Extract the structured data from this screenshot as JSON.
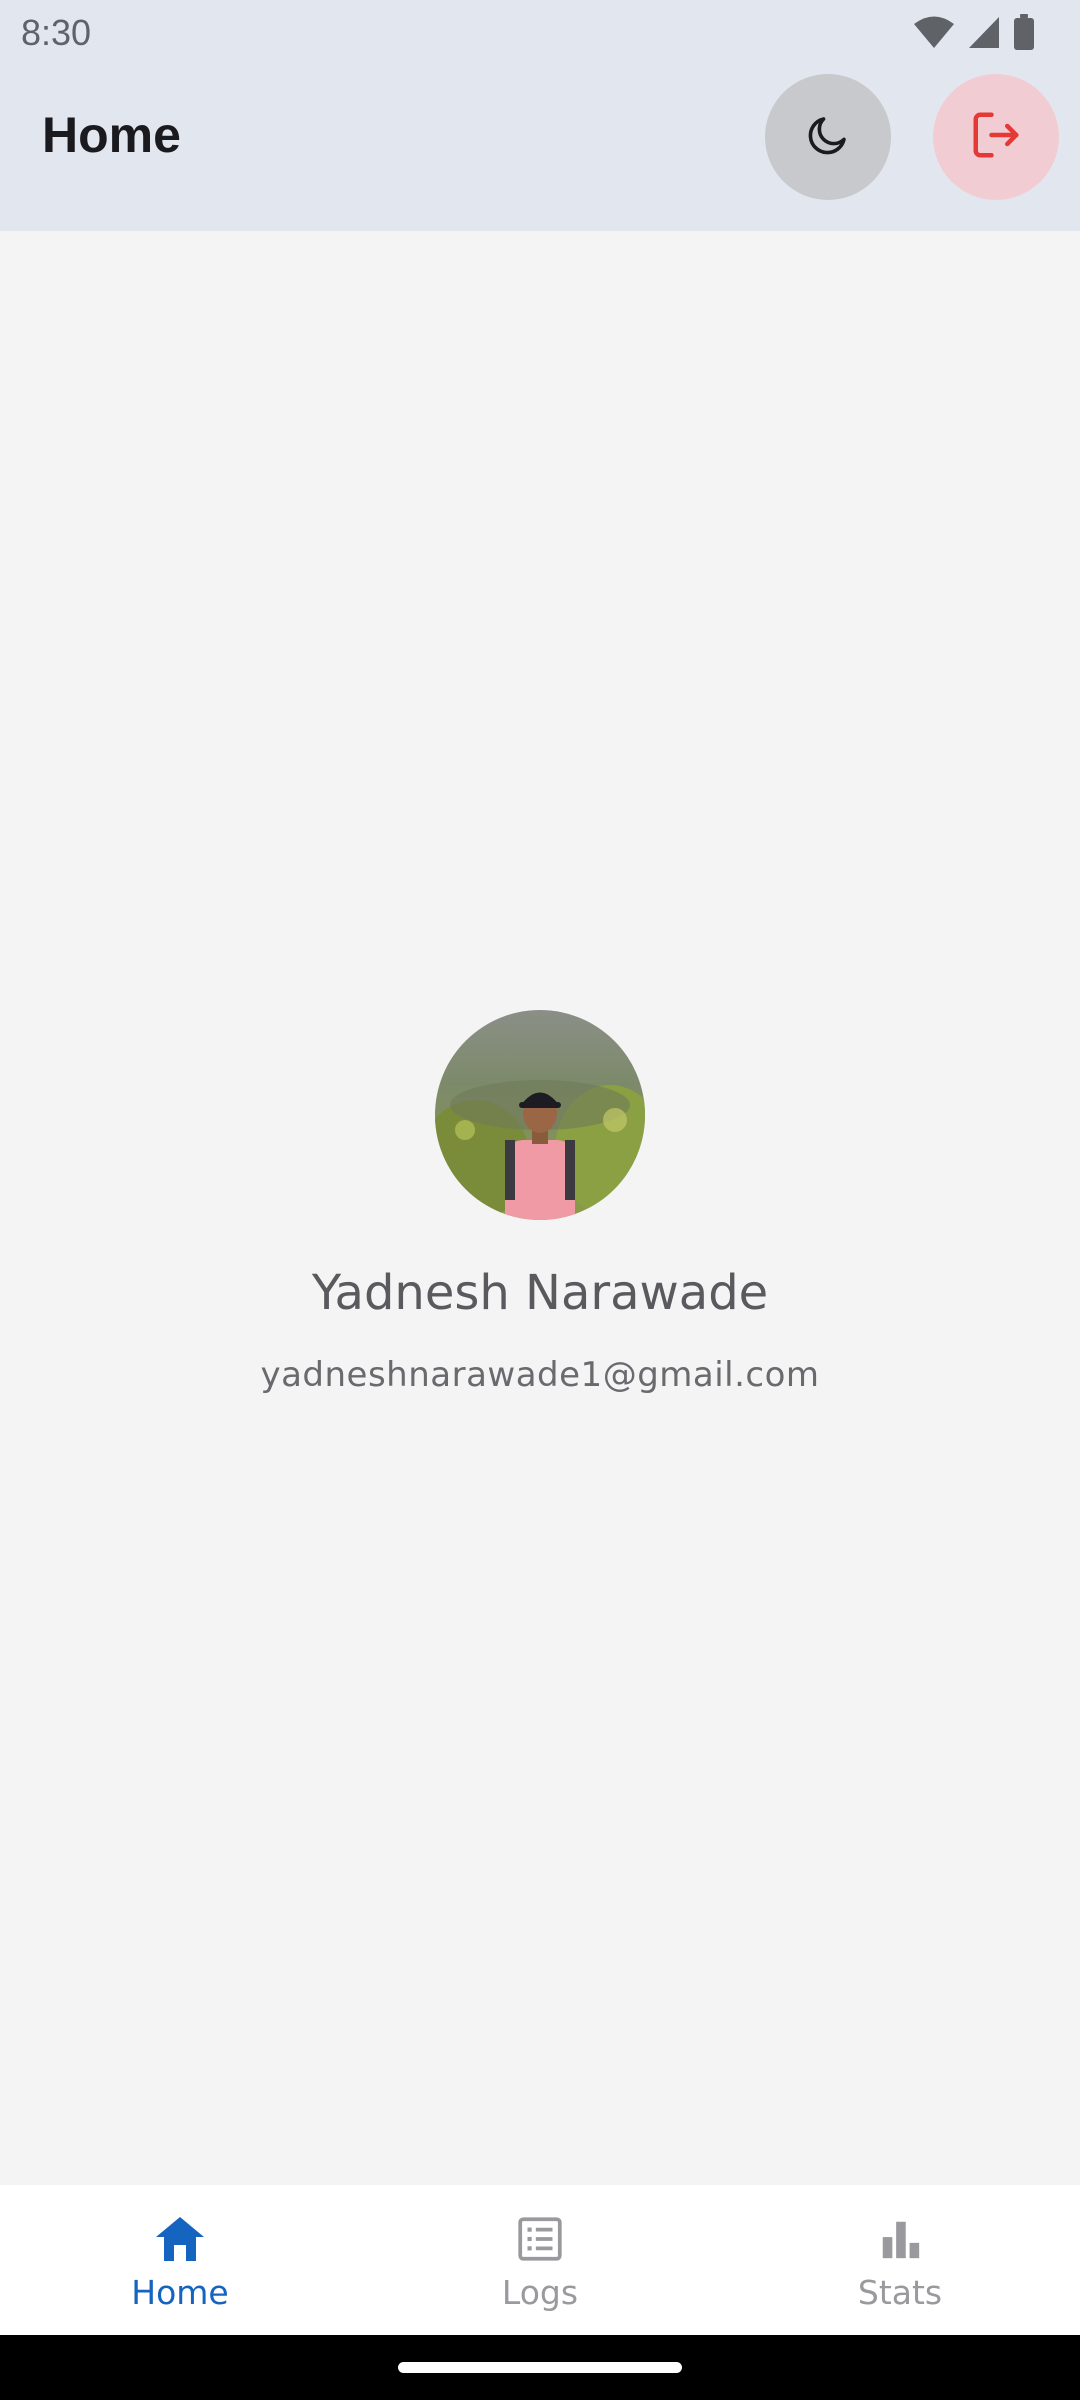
{
  "status_bar": {
    "time": "8:30",
    "icons": [
      "wifi-icon",
      "signal-icon",
      "battery-icon"
    ]
  },
  "app_bar": {
    "title": "Home",
    "theme_toggle_icon": "moon-icon",
    "logout_icon": "logout-icon"
  },
  "profile": {
    "name": "Yadnesh Narawade",
    "email": "yadneshnarawade1@gmail.com"
  },
  "bottom_nav": {
    "items": [
      {
        "label": "Home",
        "icon": "home-icon",
        "active": true
      },
      {
        "label": "Logs",
        "icon": "list-icon",
        "active": false
      },
      {
        "label": "Stats",
        "icon": "bar-chart-icon",
        "active": false
      }
    ]
  },
  "colors": {
    "app_bar_bg": "#e2e7ef",
    "background": "#f4f4f5",
    "accent": "#1565c0",
    "logout": "#e53935",
    "inactive": "#9a9a9e"
  }
}
